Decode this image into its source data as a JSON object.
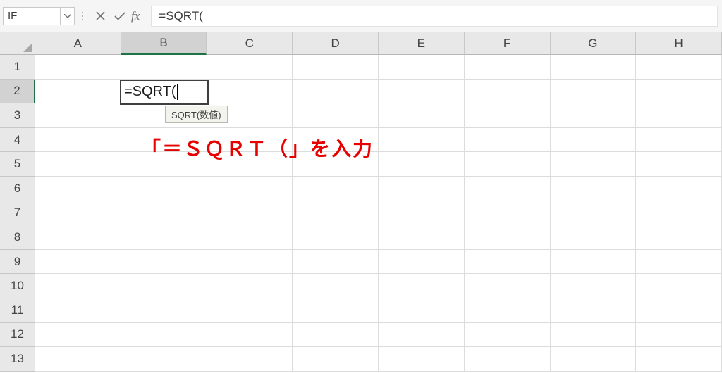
{
  "nameBox": {
    "value": "IF"
  },
  "formulaBar": {
    "cancel_tip": "Cancel",
    "enter_tip": "Enter",
    "fx_label": "fx",
    "formula": "=SQRT("
  },
  "grid": {
    "columns": [
      "A",
      "B",
      "C",
      "D",
      "E",
      "F",
      "G",
      "H"
    ],
    "rows": [
      "1",
      "2",
      "3",
      "4",
      "5",
      "6",
      "7",
      "8",
      "9",
      "10",
      "11",
      "12",
      "13"
    ],
    "activeCell": {
      "col": "B",
      "row": "2"
    },
    "editing": {
      "text": "=SQRT(",
      "tooltip": "SQRT(数値)"
    }
  },
  "annotation": {
    "text": "「＝ＳＱＲＴ（」を入力"
  }
}
